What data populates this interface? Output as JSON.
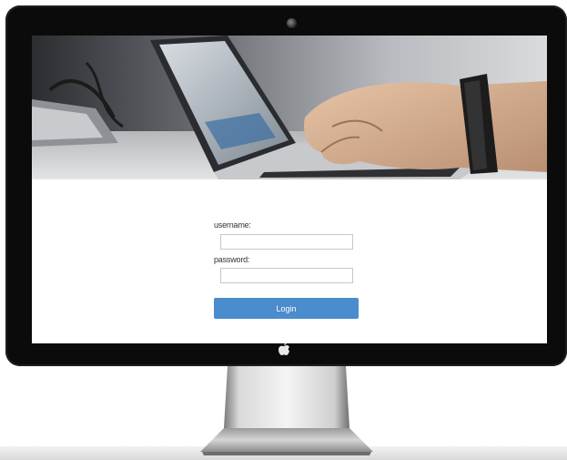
{
  "login_form": {
    "username_label": "username:",
    "username_value": "",
    "password_label": "password:",
    "password_value": "",
    "login_button_label": "Login"
  },
  "colors": {
    "bezel": "#0b0b0b",
    "screen_background": "#ffffff",
    "login_button": "#4a8ccd"
  },
  "icons": {
    "camera": "camera-icon",
    "brand_logo": "apple-logo-icon"
  }
}
